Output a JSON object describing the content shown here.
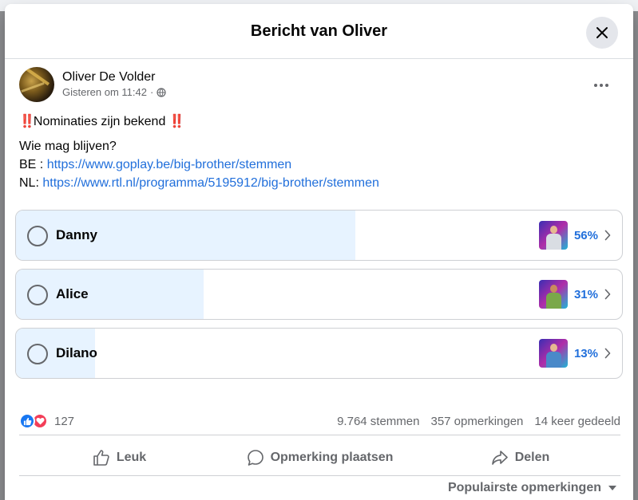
{
  "dialog": {
    "title": "Bericht van Oliver"
  },
  "post": {
    "author": "Oliver De Volder",
    "time": "Gisteren om 11:42",
    "separator": "·",
    "privacy_icon": "globe-icon",
    "bangs": "‼️",
    "line1": "Nominaties zijn bekend",
    "line2": "Wie mag blijven?",
    "be_prefix": "BE : ",
    "be_link": "https://www.goplay.be/big-brother/stemmen",
    "nl_prefix": "NL: ",
    "nl_link": "https://www.rtl.nl/programma/5195912/big-brother/stemmen"
  },
  "poll": {
    "options": [
      {
        "label": "Danny",
        "percent_label": "56%",
        "fill": 0.56
      },
      {
        "label": "Alice",
        "percent_label": "31%",
        "fill": 0.31
      },
      {
        "label": "Dilano",
        "percent_label": "13%",
        "fill": 0.13
      }
    ]
  },
  "stats": {
    "reaction_count": "127",
    "votes": "9.764 stemmen",
    "comments": "357 opmerkingen",
    "shares": "14 keer gedeeld"
  },
  "actions": {
    "like": "Leuk",
    "comment": "Opmerking plaatsen",
    "share": "Delen"
  },
  "sort": {
    "label": "Populairste opmerkingen"
  },
  "colors": {
    "accent": "#216fdb",
    "poll_fill": "#e7f3ff",
    "like_blue": "#1877f2",
    "love_red": "#f33e58",
    "muted": "#65676b"
  }
}
